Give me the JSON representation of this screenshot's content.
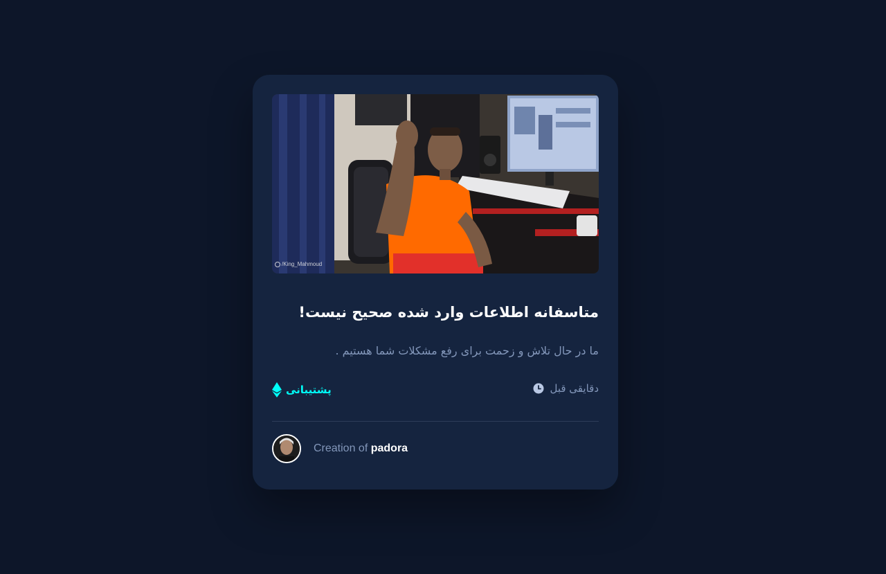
{
  "card": {
    "media": {
      "watermark": "/King_Mahmoud",
      "watermark_icon": "tiktok-icon"
    },
    "title": "متاسفانه اطلاعات وارد شده صحیح نیست!",
    "description": "ما در حال تلاش و زحمت برای رفع مشکلات شما هستیم .",
    "time": {
      "label": "دقایقی قبل",
      "icon": "clock-icon"
    },
    "support": {
      "label": "پشتیبانی",
      "icon": "ethereum-icon",
      "color": "#00fff8"
    },
    "author": {
      "prefix": "Creation of",
      "name": "padora",
      "avatar_icon": "avatar"
    }
  },
  "colors": {
    "background": "#0d1629",
    "card": "#15243f",
    "muted_text": "#8397ba",
    "accent": "#00fff8"
  }
}
